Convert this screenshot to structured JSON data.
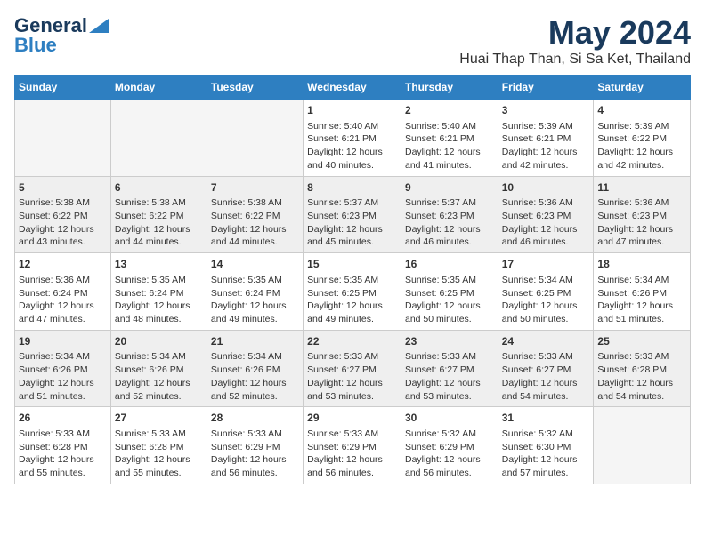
{
  "logo": {
    "line1": "General",
    "line2": "Blue"
  },
  "title": "May 2024",
  "location": "Huai Thap Than, Si Sa Ket, Thailand",
  "days_of_week": [
    "Sunday",
    "Monday",
    "Tuesday",
    "Wednesday",
    "Thursday",
    "Friday",
    "Saturday"
  ],
  "weeks": [
    [
      {
        "day": "",
        "empty": true
      },
      {
        "day": "",
        "empty": true
      },
      {
        "day": "",
        "empty": true
      },
      {
        "day": "1",
        "sunrise": "5:40 AM",
        "sunset": "6:21 PM",
        "daylight": "12 hours and 40 minutes."
      },
      {
        "day": "2",
        "sunrise": "5:40 AM",
        "sunset": "6:21 PM",
        "daylight": "12 hours and 41 minutes."
      },
      {
        "day": "3",
        "sunrise": "5:39 AM",
        "sunset": "6:21 PM",
        "daylight": "12 hours and 42 minutes."
      },
      {
        "day": "4",
        "sunrise": "5:39 AM",
        "sunset": "6:22 PM",
        "daylight": "12 hours and 42 minutes."
      }
    ],
    [
      {
        "day": "5",
        "sunrise": "5:38 AM",
        "sunset": "6:22 PM",
        "daylight": "12 hours and 43 minutes."
      },
      {
        "day": "6",
        "sunrise": "5:38 AM",
        "sunset": "6:22 PM",
        "daylight": "12 hours and 44 minutes."
      },
      {
        "day": "7",
        "sunrise": "5:38 AM",
        "sunset": "6:22 PM",
        "daylight": "12 hours and 44 minutes."
      },
      {
        "day": "8",
        "sunrise": "5:37 AM",
        "sunset": "6:23 PM",
        "daylight": "12 hours and 45 minutes."
      },
      {
        "day": "9",
        "sunrise": "5:37 AM",
        "sunset": "6:23 PM",
        "daylight": "12 hours and 46 minutes."
      },
      {
        "day": "10",
        "sunrise": "5:36 AM",
        "sunset": "6:23 PM",
        "daylight": "12 hours and 46 minutes."
      },
      {
        "day": "11",
        "sunrise": "5:36 AM",
        "sunset": "6:23 PM",
        "daylight": "12 hours and 47 minutes."
      }
    ],
    [
      {
        "day": "12",
        "sunrise": "5:36 AM",
        "sunset": "6:24 PM",
        "daylight": "12 hours and 47 minutes."
      },
      {
        "day": "13",
        "sunrise": "5:35 AM",
        "sunset": "6:24 PM",
        "daylight": "12 hours and 48 minutes."
      },
      {
        "day": "14",
        "sunrise": "5:35 AM",
        "sunset": "6:24 PM",
        "daylight": "12 hours and 49 minutes."
      },
      {
        "day": "15",
        "sunrise": "5:35 AM",
        "sunset": "6:25 PM",
        "daylight": "12 hours and 49 minutes."
      },
      {
        "day": "16",
        "sunrise": "5:35 AM",
        "sunset": "6:25 PM",
        "daylight": "12 hours and 50 minutes."
      },
      {
        "day": "17",
        "sunrise": "5:34 AM",
        "sunset": "6:25 PM",
        "daylight": "12 hours and 50 minutes."
      },
      {
        "day": "18",
        "sunrise": "5:34 AM",
        "sunset": "6:26 PM",
        "daylight": "12 hours and 51 minutes."
      }
    ],
    [
      {
        "day": "19",
        "sunrise": "5:34 AM",
        "sunset": "6:26 PM",
        "daylight": "12 hours and 51 minutes."
      },
      {
        "day": "20",
        "sunrise": "5:34 AM",
        "sunset": "6:26 PM",
        "daylight": "12 hours and 52 minutes."
      },
      {
        "day": "21",
        "sunrise": "5:34 AM",
        "sunset": "6:26 PM",
        "daylight": "12 hours and 52 minutes."
      },
      {
        "day": "22",
        "sunrise": "5:33 AM",
        "sunset": "6:27 PM",
        "daylight": "12 hours and 53 minutes."
      },
      {
        "day": "23",
        "sunrise": "5:33 AM",
        "sunset": "6:27 PM",
        "daylight": "12 hours and 53 minutes."
      },
      {
        "day": "24",
        "sunrise": "5:33 AM",
        "sunset": "6:27 PM",
        "daylight": "12 hours and 54 minutes."
      },
      {
        "day": "25",
        "sunrise": "5:33 AM",
        "sunset": "6:28 PM",
        "daylight": "12 hours and 54 minutes."
      }
    ],
    [
      {
        "day": "26",
        "sunrise": "5:33 AM",
        "sunset": "6:28 PM",
        "daylight": "12 hours and 55 minutes."
      },
      {
        "day": "27",
        "sunrise": "5:33 AM",
        "sunset": "6:28 PM",
        "daylight": "12 hours and 55 minutes."
      },
      {
        "day": "28",
        "sunrise": "5:33 AM",
        "sunset": "6:29 PM",
        "daylight": "12 hours and 56 minutes."
      },
      {
        "day": "29",
        "sunrise": "5:33 AM",
        "sunset": "6:29 PM",
        "daylight": "12 hours and 56 minutes."
      },
      {
        "day": "30",
        "sunrise": "5:32 AM",
        "sunset": "6:29 PM",
        "daylight": "12 hours and 56 minutes."
      },
      {
        "day": "31",
        "sunrise": "5:32 AM",
        "sunset": "6:30 PM",
        "daylight": "12 hours and 57 minutes."
      },
      {
        "day": "",
        "empty": true
      }
    ]
  ]
}
